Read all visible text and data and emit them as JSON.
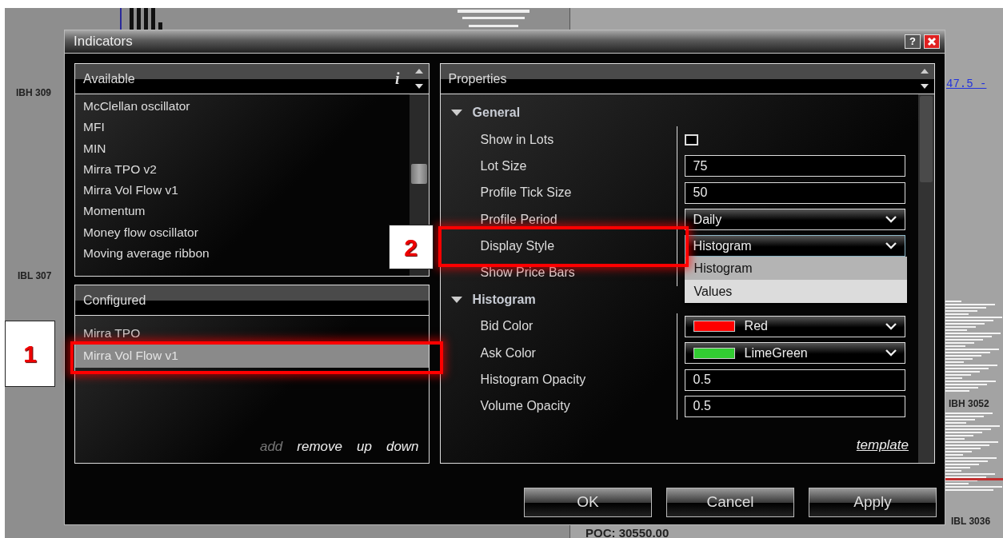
{
  "chart_labels": [
    {
      "text": "IBH 309"
    },
    {
      "text": "IBL 307"
    },
    {
      "text": "47.5 -"
    },
    {
      "text": "IBH 3052"
    },
    {
      "text": "IBL 3036"
    },
    {
      "text": "POC: 30550.00"
    }
  ],
  "window": {
    "title": "Indicators",
    "help": "?"
  },
  "available": {
    "title": "Available",
    "info": "i",
    "items": [
      "McClellan oscillator",
      "MFI",
      "MIN",
      "Mirra TPO v2",
      "Mirra Vol Flow v1",
      "Momentum",
      "Money flow oscillator",
      "Moving average ribbon"
    ]
  },
  "configured": {
    "title": "Configured",
    "items": [
      {
        "label": "Mirra TPO",
        "selected": false
      },
      {
        "label": "Mirra Vol Flow v1",
        "selected": true,
        "annotation": "1"
      }
    ],
    "actions": [
      {
        "label": "add",
        "disabled": true
      },
      {
        "label": "remove",
        "disabled": false
      },
      {
        "label": "up",
        "disabled": false
      },
      {
        "label": "down",
        "disabled": false
      }
    ]
  },
  "properties": {
    "title": "Properties",
    "groups": [
      {
        "name": "General",
        "expanded": true,
        "rows": [
          {
            "label": "Show in Lots",
            "kind": "checkbox",
            "checked": false
          },
          {
            "label": "Lot Size",
            "kind": "text",
            "value": "75"
          },
          {
            "label": "Profile Tick Size",
            "kind": "text",
            "value": "50"
          },
          {
            "label": "Profile Period",
            "kind": "select",
            "value": "Daily"
          },
          {
            "label": "Display Style",
            "kind": "select",
            "value": "Histogram",
            "open": true,
            "annotation": "2",
            "options": [
              {
                "label": "Histogram",
                "selected": true
              },
              {
                "label": "Values",
                "selected": false
              }
            ]
          },
          {
            "label": "Show Price Bars",
            "kind": "covered"
          }
        ]
      },
      {
        "name": "Histogram",
        "expanded": true,
        "rows": [
          {
            "label": "Bid Color",
            "kind": "color",
            "value": "Red",
            "color": "#ff0000"
          },
          {
            "label": "Ask Color",
            "kind": "color",
            "value": "LimeGreen",
            "color": "#32cd32"
          },
          {
            "label": "Histogram Opacity",
            "kind": "text",
            "value": "0.5"
          },
          {
            "label": "Volume Opacity",
            "kind": "text",
            "value": "0.5"
          }
        ]
      }
    ],
    "template": "template"
  },
  "buttons": [
    "OK",
    "Cancel",
    "Apply"
  ]
}
